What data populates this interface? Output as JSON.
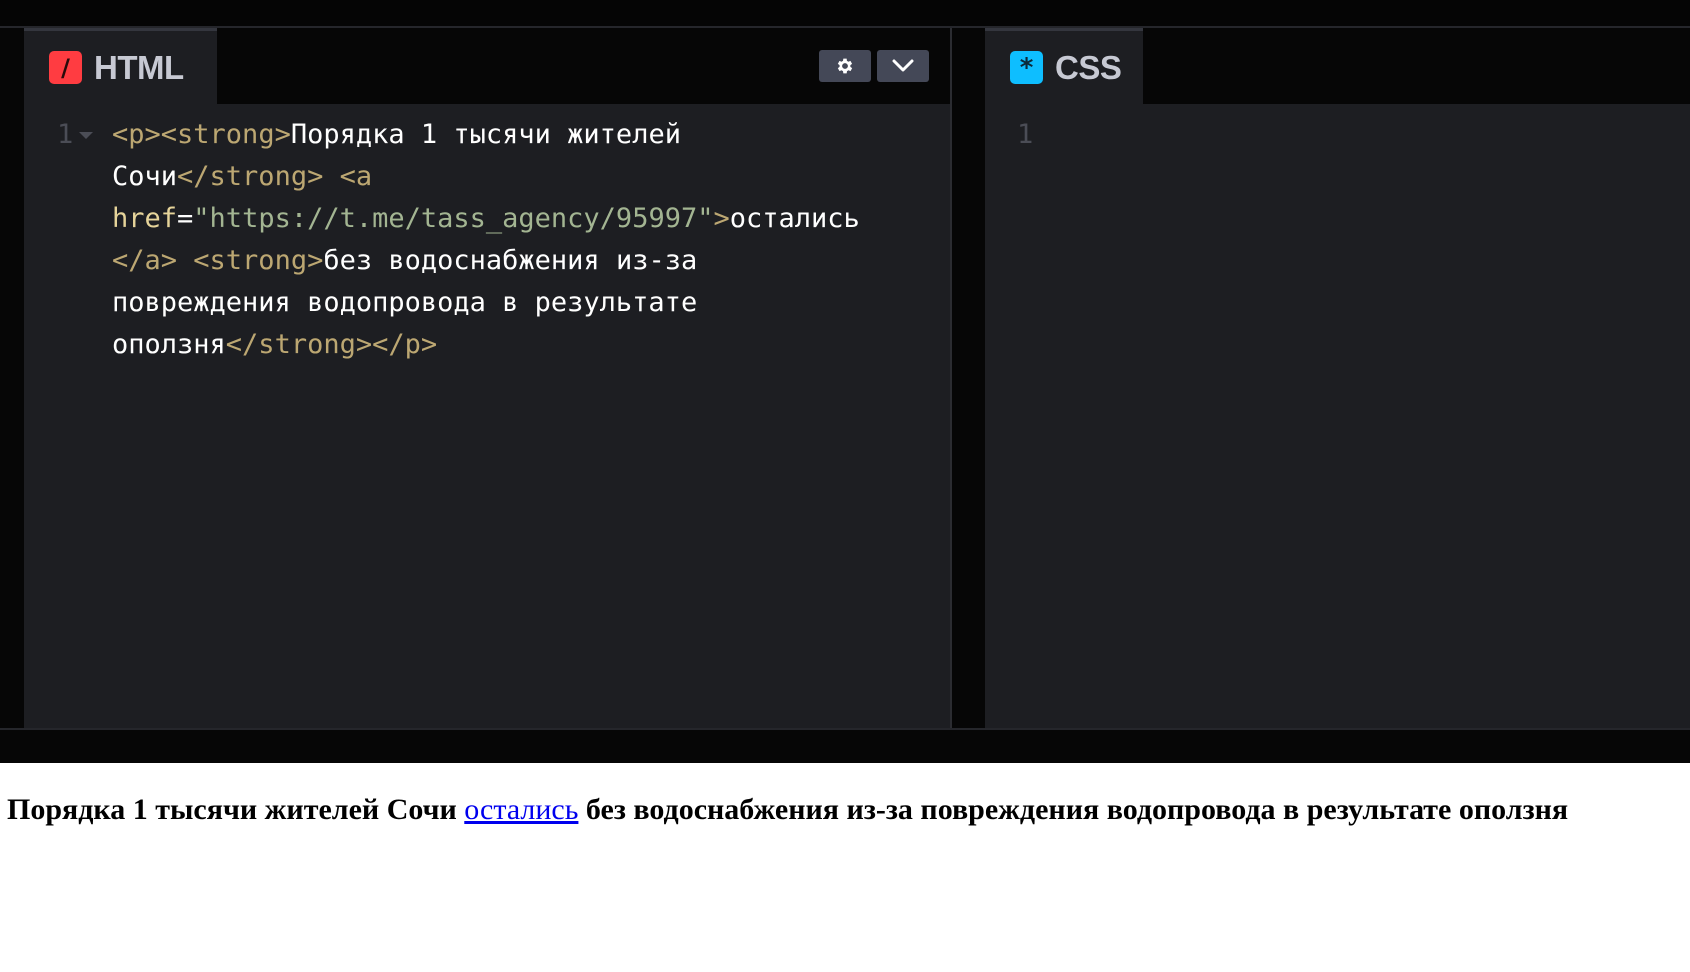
{
  "html_pane": {
    "tab_label": "HTML",
    "icon_glyph": "/",
    "line_number": "1",
    "code": {
      "l1_open_p": "<p>",
      "l1_open_strong": "<strong>",
      "l1_text": "Порядка 1 тысячи жителей",
      "l2_text": "Сочи",
      "l2_close_strong": "</strong>",
      "l2_open_a": " <a",
      "l3_attr": "href",
      "l3_eq": "=",
      "l3_value": "\"https://t.me/tass_agency/95997\"",
      "l3_gt": ">",
      "l3_text": "остались",
      "l4_close_a": "</a>",
      "l4_open_strong": " <strong>",
      "l4_text": "без водоснабжения из-за",
      "l5_text": "повреждения водопровода в результате",
      "l6_text": "оползня",
      "l6_close": "</strong></p>"
    },
    "buttons": [
      "gear-icon",
      "chevron-down-icon"
    ]
  },
  "css_pane": {
    "tab_label": "CSS",
    "icon_glyph": "*",
    "line_number": "1"
  },
  "preview": {
    "before_link": "Порядка 1 тысячи жителей Сочи",
    "link_text": "остались",
    "after_link": "без водоснабжения из-за повреждения водопровода в результате оползня"
  },
  "colors": {
    "editor_bg": "#1d1e22",
    "html_icon": "#ff3c41",
    "css_icon": "#0ebeff",
    "tag": "#bca772",
    "attr": "#e6d49a",
    "string": "#a3b592",
    "link": "#0000ee"
  }
}
